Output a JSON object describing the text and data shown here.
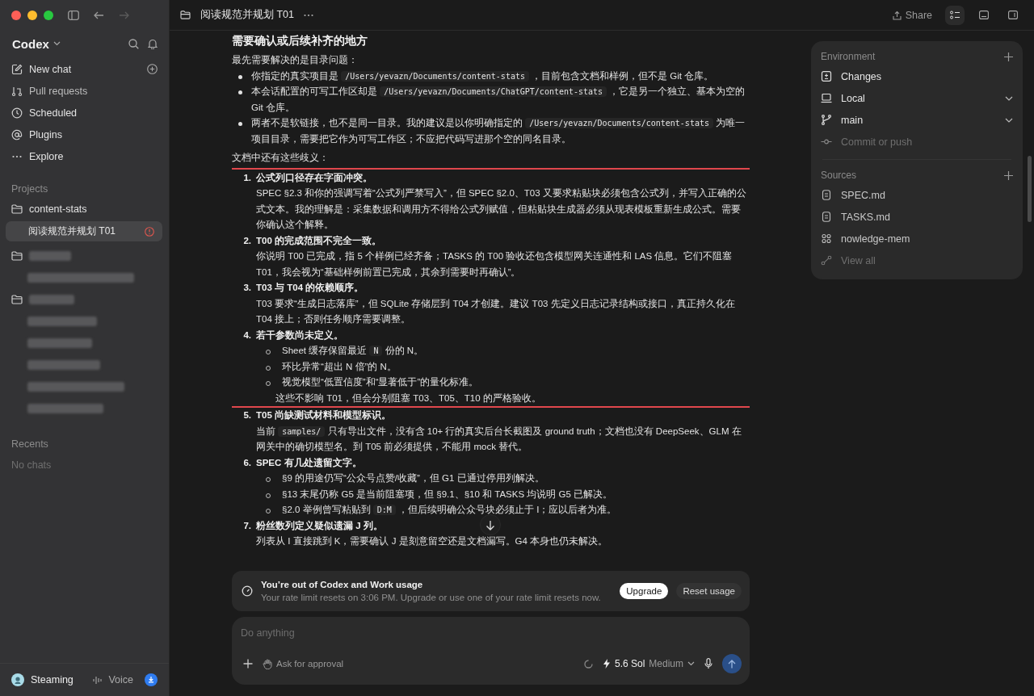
{
  "window": {
    "title": "阅读规范并规划 T01"
  },
  "sidebar": {
    "app_name": "Codex",
    "nav": [
      {
        "label": "New chat"
      },
      {
        "label": "Pull requests"
      },
      {
        "label": "Scheduled"
      },
      {
        "label": "Plugins"
      },
      {
        "label": "Explore"
      }
    ],
    "projects_heading": "Projects",
    "projects": [
      {
        "name": "content-stats",
        "chats": [
          {
            "title": "阅读规范并规划 T01",
            "selected": true,
            "alert": true
          }
        ]
      }
    ],
    "recents_heading": "Recents",
    "recents_empty": "No chats",
    "user": "Steaming",
    "voice": "Voice"
  },
  "toolbar": {
    "share": "Share"
  },
  "message": {
    "heading": "需要确认或后续补齐的地方",
    "intro": "最先需要解决的是目录问题：",
    "bullets": [
      [
        {
          "kind": "text",
          "text": "你指定的真实项目是 "
        },
        {
          "kind": "code",
          "text": "/Users/yevazn/Documents/content-stats"
        },
        {
          "kind": "text",
          "text": " ，目前包含文档和样例，但不是 Git 仓库。"
        }
      ],
      [
        {
          "kind": "text",
          "text": "本会话配置的可写工作区却是 "
        },
        {
          "kind": "code",
          "text": "/Users/yevazn/Documents/ChatGPT/content-stats"
        },
        {
          "kind": "text",
          "text": " ，它是另一个独立、基本为空的 Git 仓库。"
        }
      ],
      [
        {
          "kind": "text",
          "text": "两者不是软链接，也不是同一目录。我的建议是以你明确指定的 "
        },
        {
          "kind": "code",
          "text": "/Users/yevazn/Documents/content-stats"
        },
        {
          "kind": "text",
          "text": " 为唯一项目目录，需要把它作为可写工作区；不应把代码写进那个空的同名目录。"
        }
      ]
    ],
    "issues_intro": "文档中还有这些歧义：",
    "issues": [
      {
        "number": "1.",
        "title": "公式列口径存在字面冲突。",
        "highlighted": true,
        "body": [
          {
            "kind": "text",
            "text": "SPEC §2.3 和你的强调写着“公式列严禁写入”，但 SPEC §2.0、T03 又要求粘贴块必须包含公式列，并写入正确的公式文本。我的理解是：采集数据和调用方不得给公式列赋值，但粘贴块生成器必须从现表模板重新生成公式。需要你确认这个解释。"
          }
        ]
      },
      {
        "number": "2.",
        "title": "T00 的完成范围不完全一致。",
        "highlighted": true,
        "body": [
          {
            "kind": "text",
            "text": "你说明 T00 已完成，指 5 个样例已经齐备；TASKS 的 T00 验收还包含模型网关连通性和 LAS 信息。它们不阻塞 T01，我会视为“基础样例前置已完成，其余到需要时再确认”。"
          }
        ]
      },
      {
        "number": "3.",
        "title": "T03 与 T04 的依赖顺序。",
        "highlighted": true,
        "body": [
          {
            "kind": "text",
            "text": "T03 要求“生成日志落库”，但 SQLite 存储层到 T04 才创建。建议 T03 先定义日志记录结构或接口，真正持久化在 T04 接上；否则任务顺序需要调整。"
          }
        ]
      },
      {
        "number": "4.",
        "title": "若干参数尚未定义。",
        "highlighted": true,
        "subitems": [
          [
            {
              "kind": "text",
              "text": "Sheet 缓存保留最近 "
            },
            {
              "kind": "code",
              "text": "N"
            },
            {
              "kind": "text",
              "text": " 份的 N。"
            }
          ],
          [
            {
              "kind": "text",
              "text": "环比异常“超出 N 倍”的 N。"
            }
          ],
          [
            {
              "kind": "text",
              "text": "视觉模型“低置信度”和“显著低于”的量化标准。"
            }
          ]
        ],
        "note": [
          {
            "kind": "text",
            "text": "这些不影响 T01，但会分别阻塞 T03、T05、T10 的严格验收。"
          }
        ]
      },
      {
        "number": "5.",
        "title": "T05 尚缺测试材料和模型标识。",
        "highlighted": false,
        "body": [
          {
            "kind": "text",
            "text": "当前 "
          },
          {
            "kind": "code",
            "text": "samples/"
          },
          {
            "kind": "text",
            "text": " 只有导出文件，没有含 10+ 行的真实后台长截图及 ground truth；文档也没有 DeepSeek、GLM 在网关中的确切模型名。到 T05 前必须提供，不能用 mock 替代。"
          }
        ]
      },
      {
        "number": "6.",
        "title": "SPEC 有几处遗留文字。",
        "highlighted": false,
        "subitems": [
          [
            {
              "kind": "text",
              "text": "§9 的用途仍写“公众号点赞/收藏”，但 G1 已通过停用列解决。"
            }
          ],
          [
            {
              "kind": "text",
              "text": "§13 末尾仍称 G5 是当前阻塞项，但 §9.1、§10 和 TASKS 均说明 G5 已解决。"
            }
          ],
          [
            {
              "kind": "text",
              "text": "§2.0 举例曾写粘贴到 "
            },
            {
              "kind": "code",
              "text": "D:M"
            },
            {
              "kind": "text",
              "text": " ，但后续明确公众号块必须止于 I；应以后者为准。"
            }
          ]
        ]
      },
      {
        "number": "7.",
        "title": "粉丝数列定义疑似遗漏 J 列。",
        "highlighted": false,
        "body": [
          {
            "kind": "text",
            "text": "列表从 I 直接跳到 K，需要确认 J 是刻意留空还是文档漏写。G4 本身也仍未解决。"
          }
        ]
      }
    ]
  },
  "usage_banner": {
    "title": "You’re out of Codex and Work usage",
    "text": "Your rate limit resets on 3:06 PM. Upgrade or use one of your rate limit resets now.",
    "upgrade": "Upgrade",
    "reset": "Reset usage"
  },
  "composer": {
    "placeholder": "Do anything",
    "approval": "Ask for approval",
    "model": "5.6 Sol",
    "effort": "Medium"
  },
  "panel": {
    "environment_heading": "Environment",
    "environment": [
      {
        "label": "Changes",
        "dropdown": false,
        "disabled": false
      },
      {
        "label": "Local",
        "dropdown": true,
        "disabled": false
      },
      {
        "label": "main",
        "dropdown": true,
        "disabled": false
      },
      {
        "label": "Commit or push",
        "dropdown": false,
        "disabled": true
      }
    ],
    "sources_heading": "Sources",
    "sources": [
      {
        "label": "SPEC.md",
        "kind": "doc",
        "disabled": false
      },
      {
        "label": "TASKS.md",
        "kind": "doc",
        "disabled": false
      },
      {
        "label": "nowledge-mem",
        "kind": "plugin",
        "disabled": false
      },
      {
        "label": "View all",
        "kind": "link",
        "disabled": true
      }
    ]
  }
}
